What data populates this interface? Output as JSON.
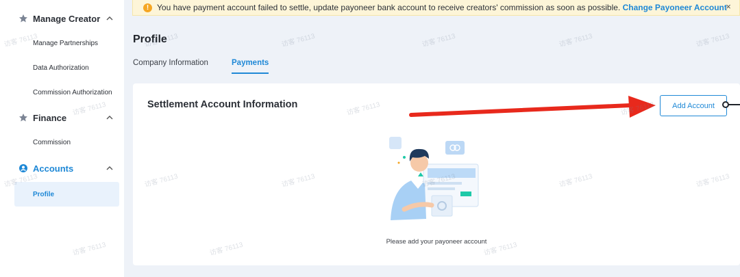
{
  "sidebar": {
    "groups": [
      {
        "label": "Manage Creator",
        "icon": "star-icon",
        "items": [
          "Manage Partnerships",
          "Data Authorization",
          "Commission Authorization"
        ]
      },
      {
        "label": "Finance",
        "icon": "star-icon",
        "items": [
          "Commission"
        ]
      },
      {
        "label": "Accounts",
        "icon": "user-circle-icon",
        "items": [
          "Profile"
        ]
      }
    ],
    "active_item": "Profile"
  },
  "banner": {
    "message": "You have payment account failed to settle, update payoneer bank account to receive creators' commission as soon as possible.",
    "link_label": "Change Payoneer Account",
    "close_label": "×",
    "icon_label": "!"
  },
  "page": {
    "title": "Profile",
    "tabs": [
      {
        "label": "Company Information",
        "active": false
      },
      {
        "label": "Payments",
        "active": true
      }
    ]
  },
  "card": {
    "title": "Settlement Account Information",
    "add_button_label": "Add Account",
    "empty_text": "Please add your payoneer account"
  },
  "watermark_text": "访客 76113",
  "colors": {
    "accent": "#1e88d6",
    "banner_bg": "#fdf5d8",
    "warning": "#f5a623",
    "annotation_arrow": "#e8291c",
    "page_bg": "#eef2f8"
  }
}
